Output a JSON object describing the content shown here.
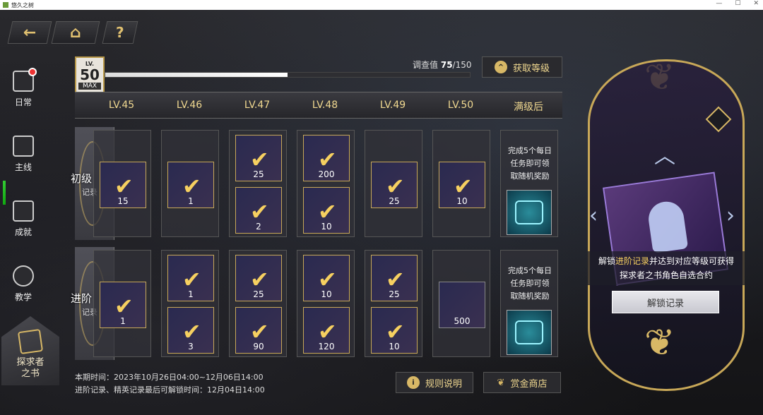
{
  "window": {
    "title": "悠久之树",
    "min": "—",
    "max": "☐",
    "close": "✕"
  },
  "nav": {
    "back_icon": "←",
    "home_icon": "⌂",
    "help": "?"
  },
  "sidebar": {
    "items": [
      {
        "label": "日常",
        "icon": "calendar-icon"
      },
      {
        "label": "主线",
        "icon": "scroll-icon"
      },
      {
        "label": "成就",
        "icon": "trophy-icon"
      },
      {
        "label": "教学",
        "icon": "teaching-icon"
      }
    ],
    "book_line1": "探求者",
    "book_line2": "之书"
  },
  "level": {
    "lv": "LV.",
    "value": "50",
    "max": "MAX",
    "investigation_label": "调查值",
    "investigation_value": "75",
    "investigation_total": "/150",
    "progress": 0.5,
    "get_level": "获取等级",
    "get_level_icon": "^"
  },
  "levels": [
    "LV.45",
    "LV.46",
    "LV.47",
    "LV.48",
    "LV.49",
    "LV.50",
    "满级后"
  ],
  "rows": [
    {
      "tag": "初级",
      "sub": "记录",
      "cols": [
        [
          {
            "num": "15"
          }
        ],
        [
          {
            "num": "1"
          }
        ],
        [
          {
            "num": "25"
          },
          {
            "num": "2"
          }
        ],
        [
          {
            "num": "200"
          },
          {
            "num": "10"
          }
        ],
        [
          {
            "num": "25"
          }
        ],
        [
          {
            "num": "10"
          }
        ]
      ],
      "desc": [
        "完成5个每日",
        "任务即可领",
        "取随机奖励"
      ]
    },
    {
      "tag": "进阶",
      "sub": "记录",
      "cols": [
        [
          {
            "num": "1"
          }
        ],
        [
          {
            "num": "1"
          },
          {
            "num": "3"
          }
        ],
        [
          {
            "num": "25"
          },
          {
            "num": "90"
          }
        ],
        [
          {
            "num": "10"
          },
          {
            "num": "120"
          }
        ],
        [
          {
            "num": "25"
          },
          {
            "num": "10"
          }
        ],
        [
          {
            "num": "500"
          }
        ]
      ],
      "desc": [
        "完成5个每日",
        "任务即可领",
        "取随机奖励"
      ]
    }
  ],
  "footer": {
    "period": "本期时间：2023年10月26日04:00~12月06日14:00",
    "deadline": "进阶记录、精英记录最后可解锁时间：12月04日14:00",
    "rules": "规则说明",
    "rules_icon": "i",
    "shop": "赏金商店"
  },
  "panel": {
    "text_pre": "解锁",
    "text_hl": "进阶记录",
    "text_post": "并达到对应等级可获得",
    "text_line2": "探求者之书角色自选合约",
    "unlock": "解锁记录"
  }
}
